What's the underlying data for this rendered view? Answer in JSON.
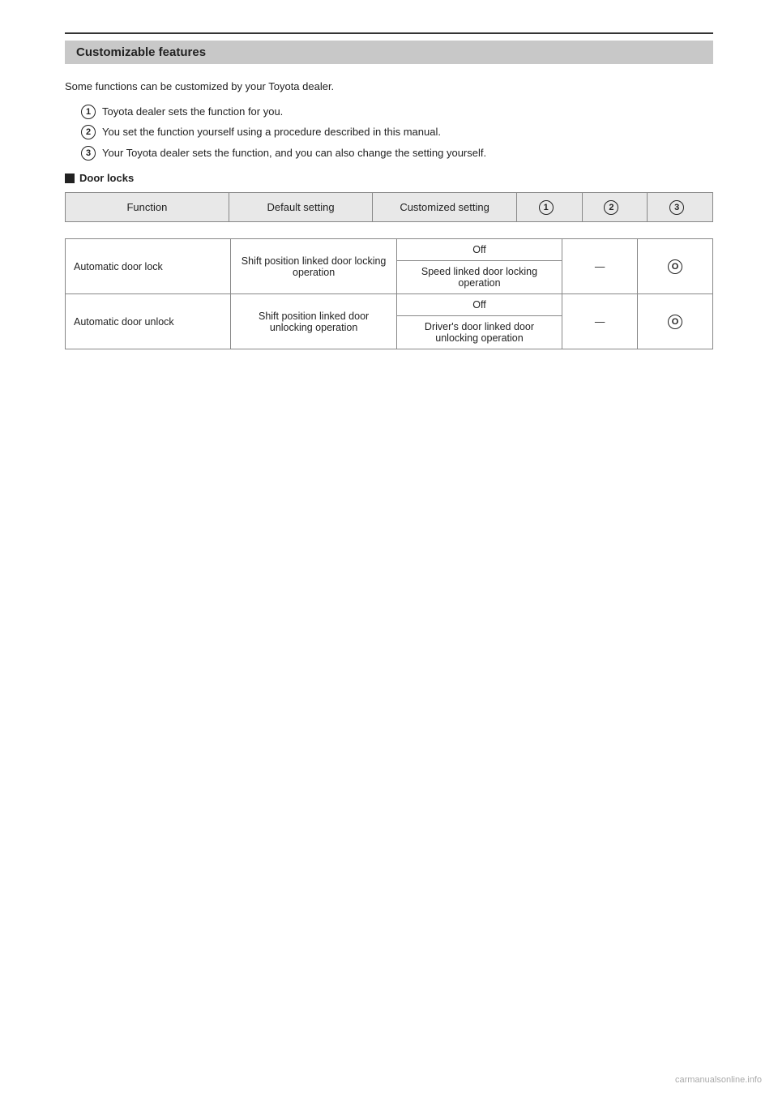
{
  "page": {
    "top_rule": true,
    "section_header": "Customizable features",
    "intro_text": "Some functions can be customized by your Toyota dealer.",
    "list_items": [
      {
        "num": "1",
        "text": "Toyota dealer sets the function for you."
      },
      {
        "num": "2",
        "text": "You set the function yourself using a procedure described in this manual."
      },
      {
        "num": "3",
        "text": "Your Toyota dealer sets the function, and you can also change the setting yourself."
      }
    ],
    "sub_heading": "Door locks",
    "header_row": {
      "function": "Function",
      "default_setting": "Default setting",
      "customized_setting": "Customized setting",
      "num1": "1",
      "num2": "2",
      "num3": "3"
    },
    "table_rows": [
      {
        "function": "Automatic door lock",
        "default": "Shift position linked door locking operation",
        "options": [
          {
            "label": "Off",
            "dash": "—",
            "circle": "O"
          },
          {
            "label": "Speed linked door locking operation",
            "dash": "—",
            "circle": "O"
          }
        ]
      },
      {
        "function": "Automatic door unlock",
        "default": "Shift position linked door unlocking operation",
        "options": [
          {
            "label": "Off",
            "dash": "—",
            "circle": "O"
          },
          {
            "label": "Driver's door linked door unlocking operation",
            "dash": "—",
            "circle": "O"
          }
        ]
      }
    ],
    "watermark": "carmanualsonline.info"
  }
}
